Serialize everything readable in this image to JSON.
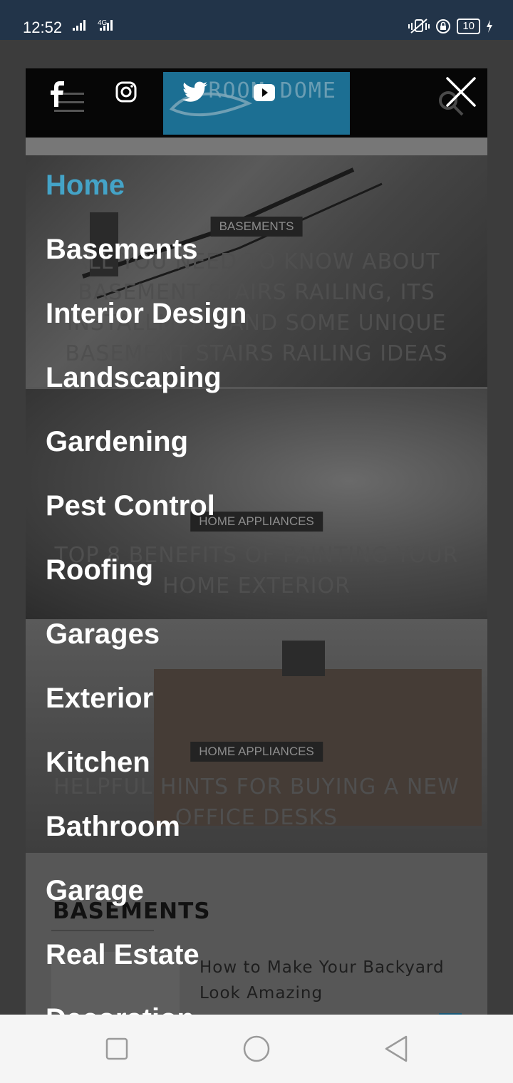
{
  "status_bar": {
    "time": "12:52",
    "network": "4G",
    "battery": "10"
  },
  "header": {
    "logo_text": "ROOM DOME",
    "social_icons": [
      "facebook-icon",
      "instagram-icon",
      "twitter-icon",
      "youtube-icon"
    ]
  },
  "menu": {
    "items": [
      "Home",
      "Basements",
      "Interior Design",
      "Landscaping",
      "Gardening",
      "Pest Control",
      "Roofing",
      "Garages",
      "Exterior",
      "Kitchen",
      "Bathroom",
      "Garage",
      "Real Estate",
      "Decoration"
    ],
    "active": "Home"
  },
  "articles": [
    {
      "category": "BASEMENTS",
      "title": "ALL YOU NEED TO KNOW ABOUT BASEMENT STAIRS RAILING, ITS INSTALLMENT AND SOME UNIQUE BASEMENT STAIRS RAILING IDEAS"
    },
    {
      "category": "HOME APPLIANCES",
      "title": "TOP 8 BENEFITS OF PAINTING YOUR HOME EXTERIOR"
    },
    {
      "category": "HOME APPLIANCES",
      "title": "HELPFUL HINTS FOR BUYING A NEW OFFICE DESKS"
    }
  ],
  "section": {
    "heading": "BASEMENTS",
    "post_title": "How to Make Your Backyard Look Amazing"
  },
  "colors": {
    "accent": "#44a3c7",
    "status_bar": "#223449",
    "header": "#060606"
  }
}
